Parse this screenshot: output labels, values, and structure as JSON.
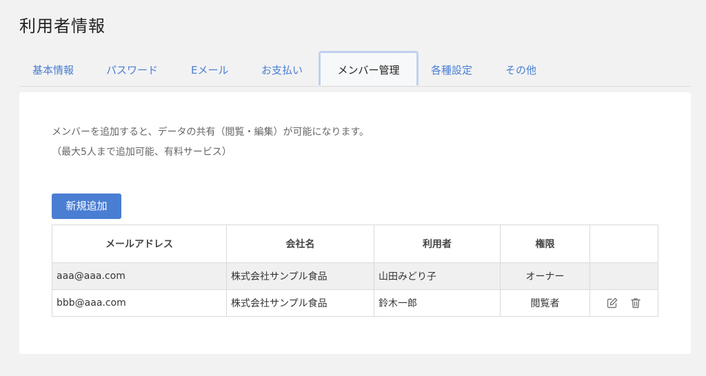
{
  "page": {
    "title": "利用者情報"
  },
  "tabs": [
    {
      "label": "基本情報"
    },
    {
      "label": "パスワード"
    },
    {
      "label": "Eメール"
    },
    {
      "label": "お支払い"
    },
    {
      "label": "メンバー管理",
      "active": true
    },
    {
      "label": "各種設定"
    },
    {
      "label": "その他"
    }
  ],
  "members": {
    "description_line1": "メンバーを追加すると、データの共有（閲覧・編集）が可能になります。",
    "description_line2": "（最大5人まで追加可能、有料サービス）",
    "add_button_label": "新規追加",
    "table": {
      "headers": [
        "メールアドレス",
        "会社名",
        "利用者",
        "権限",
        ""
      ],
      "rows": [
        {
          "email": "aaa@aaa.com",
          "company": "株式会社サンプル食品",
          "user": "山田みどり子",
          "role": "オーナー",
          "actions": []
        },
        {
          "email": "bbb@aaa.com",
          "company": "株式会社サンプル食品",
          "user": "鈴木一郎",
          "role": "閲覧者",
          "actions": [
            "edit-icon",
            "trash-icon"
          ]
        }
      ]
    }
  },
  "colors": {
    "accent": "#4a7ed3",
    "background": "#f2f2f2",
    "card": "#ffffff",
    "active_tab_border": "#bfd0ee",
    "owner_row": "#f0f0f0"
  }
}
